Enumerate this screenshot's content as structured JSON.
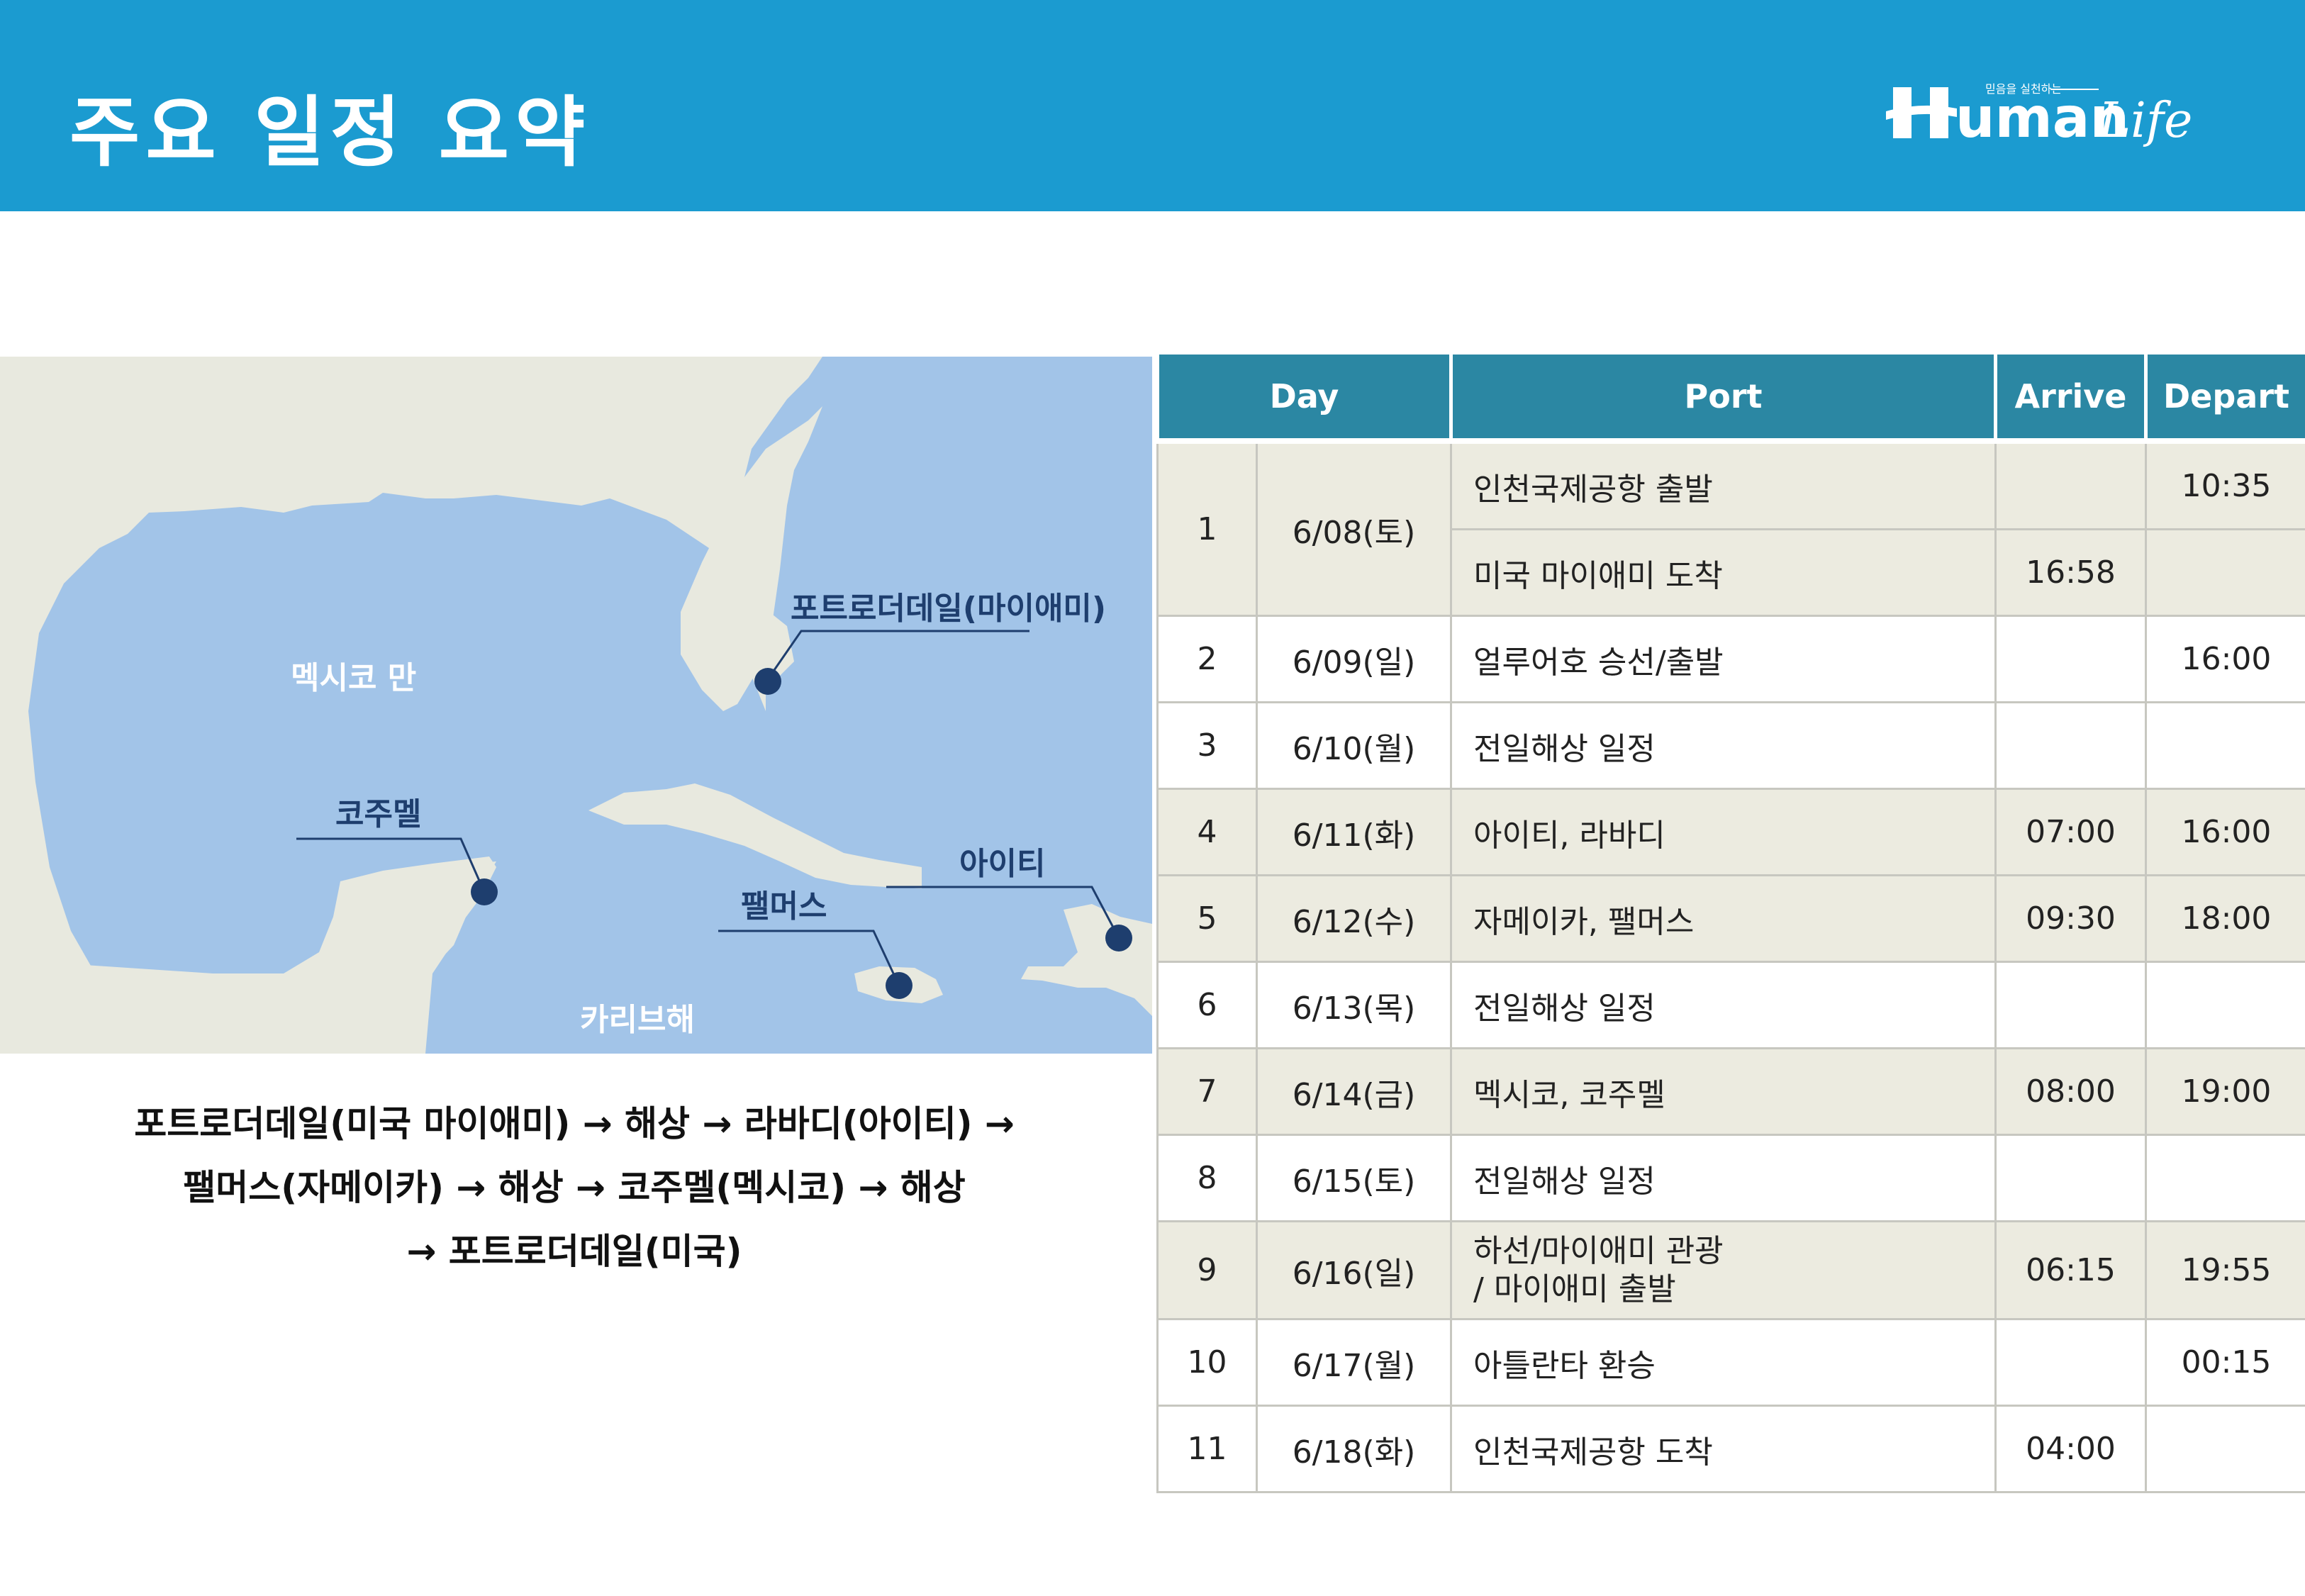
{
  "header": {
    "title": "주요 일정 요약",
    "logo_main": "uman",
    "logo_script": "Life",
    "logo_tagline": "믿음을 실천하는"
  },
  "map": {
    "labels": {
      "fort_lauderdale": "포트로더데일(마이애미)",
      "gulf": "멕시코 만",
      "cozumel": "코주멜",
      "haiti": "아이티",
      "palmas": "팰머스",
      "caribbean": "카리브해"
    },
    "colors": {
      "sea": "#a2c4e8",
      "land": "#e8e9df",
      "marker": "#1e3e6e"
    }
  },
  "route": {
    "line1": "포트로더데일(미국 마이애미) → 해상 → 라바디(아이티) →",
    "line2": "팰머스(자메이카) → 해상 → 코주멜(멕시코) → 해상",
    "line3": "→ 포트로더데일(미국)"
  },
  "table": {
    "headers": {
      "day": "Day",
      "port": "Port",
      "arrive": "Arrive",
      "depart": "Depart"
    },
    "rows": [
      {
        "no": "1",
        "date": "6/08(토)",
        "port": "인천국제공항 출발",
        "arrive": "",
        "depart": "10:35"
      },
      {
        "no": "",
        "date": "",
        "port": "미국 마이애미 도착",
        "arrive": "16:58",
        "depart": ""
      },
      {
        "no": "2",
        "date": "6/09(일)",
        "port": "얼루어호 승선/출발",
        "arrive": "",
        "depart": "16:00"
      },
      {
        "no": "3",
        "date": "6/10(월)",
        "port": "전일해상 일정",
        "arrive": "",
        "depart": ""
      },
      {
        "no": "4",
        "date": "6/11(화)",
        "port": "아이티, 라바디",
        "arrive": "07:00",
        "depart": "16:00"
      },
      {
        "no": "5",
        "date": "6/12(수)",
        "port": "자메이카, 팰머스",
        "arrive": "09:30",
        "depart": "18:00"
      },
      {
        "no": "6",
        "date": "6/13(목)",
        "port": "전일해상 일정",
        "arrive": "",
        "depart": ""
      },
      {
        "no": "7",
        "date": "6/14(금)",
        "port": "멕시코, 코주멜",
        "arrive": "08:00",
        "depart": "19:00"
      },
      {
        "no": "8",
        "date": "6/15(토)",
        "port": "전일해상 일정",
        "arrive": "",
        "depart": ""
      },
      {
        "no": "9",
        "date": "6/16(일)",
        "port_line1": "하선/마이애미 관광",
        "port_line2": "/ 마이애미 출발",
        "arrive": "06:15",
        "depart": "19:55"
      },
      {
        "no": "10",
        "date": "6/17(월)",
        "port": "아틀란타 환승",
        "arrive": "",
        "depart": "00:15"
      },
      {
        "no": "11",
        "date": "6/18(화)",
        "port": "인천국제공항 도착",
        "arrive": "04:00",
        "depart": ""
      }
    ]
  }
}
